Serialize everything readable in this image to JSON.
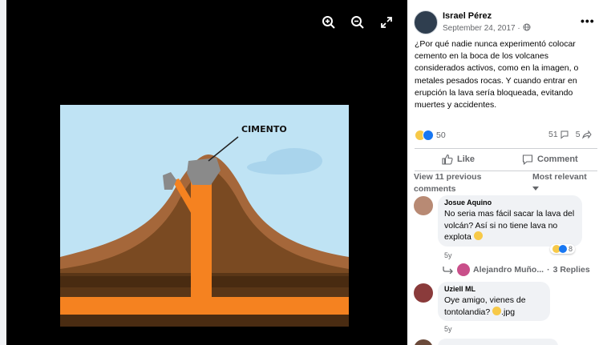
{
  "viewer": {
    "image_label": "CIMENTO"
  },
  "post": {
    "author": "Israel Pérez",
    "date": "September 24, 2017 ·",
    "more": "•••",
    "text": "¿Por qué nadie nunca experimentó colocar cemento en la boca de los volcanes considerados activos, como en la imagen, o metales pesados rocas. Y cuando entrar en erupción la lava sería bloqueada, evitando muertes y accidentes.",
    "reaction_count": "50",
    "comment_count": "51",
    "share_count": "5"
  },
  "actions": {
    "like": "Like",
    "comment": "Comment"
  },
  "comments_header": {
    "view_previous": "View 11 previous comments",
    "sort": "Most relevant"
  },
  "comments": [
    {
      "author": "Josue Aquino",
      "text": "No seria mas fácil sacar la lava del volcán? Así si no tiene lava no explota",
      "reaction_count": "8",
      "time": "5y"
    },
    {
      "author": "Uziell ML",
      "text": "Oye amigo, vienes de tontolandia? ",
      "text_suffix": ".jpg",
      "time": "5y"
    }
  ],
  "reply_thread": {
    "author": "Alejandro Muño...",
    "sep": "·",
    "replies": "3 Replies"
  },
  "colors": {
    "sky": "#bfe3f4",
    "lava": "#f58220",
    "mountain": "#8b5a2b",
    "cement": "#8a8a8a",
    "like_blue": "#1877f2"
  }
}
